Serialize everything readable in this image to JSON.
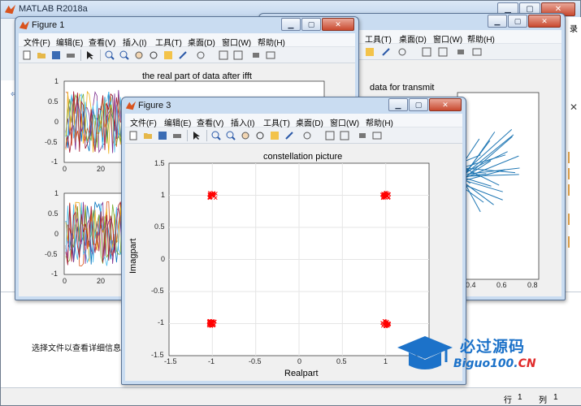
{
  "main_window": {
    "title": "MATLAB R2018a",
    "partial_label_right": "录",
    "details_text": "选择文件以查看详细信息",
    "left_fragment": "详",
    "status": {
      "row_label": "行",
      "row_value": "1",
      "col_label": "列",
      "col_value": "1"
    }
  },
  "menus": [
    "文件(F)",
    "编辑(E)",
    "查看(V)",
    "插入(I)",
    "工具(T)",
    "桌面(D)",
    "窗口(W)",
    "帮助(H)"
  ],
  "figure1": {
    "title": "Figure 1",
    "subplot_top": {
      "title": "the real part of data after ifft",
      "yticks": [
        "1",
        "0.5",
        "0",
        "-0.5",
        "-1"
      ],
      "xticks": [
        "0",
        "20"
      ]
    },
    "subplot_bottom": {
      "yticks": [
        "1",
        "0.5",
        "0",
        "-0.5",
        "-1"
      ],
      "xticks": [
        "0",
        "20"
      ]
    }
  },
  "figure2": {
    "title": "data for transmit",
    "xticks": [
      "0.4",
      "0.6",
      "0.8"
    ]
  },
  "figure3": {
    "title": "Figure 3",
    "plot_title": "constellation picture",
    "xlabel": "Realpart",
    "ylabel": "Imagpart",
    "xticks": [
      "-1.5",
      "-1",
      "-0.5",
      "0",
      "0.5",
      "1",
      "1.5"
    ],
    "yticks": [
      "1.5",
      "1",
      "0.5",
      "0",
      "-0.5",
      "-1",
      "-1.5"
    ]
  },
  "chart_data": [
    {
      "type": "scatter",
      "title": "constellation picture",
      "xlabel": "Realpart",
      "ylabel": "Imagpart",
      "xlim": [
        -1.5,
        1.5
      ],
      "ylim": [
        -1.5,
        1.5
      ],
      "grid": true,
      "marker_color": "#ff0000",
      "series": [
        {
          "x": [
            -1,
            1,
            -1,
            1
          ],
          "y": [
            1,
            1,
            -1,
            -1
          ]
        }
      ]
    }
  ],
  "watermark": {
    "cn": "必过源码",
    "en": "Biguo100.",
    "en_suffix": "CN"
  },
  "colors": {
    "aero_title": "#c9dcf1",
    "marker": "#ff0000",
    "line_blue": "#1f77b4",
    "watermark": "#1c72c9"
  }
}
